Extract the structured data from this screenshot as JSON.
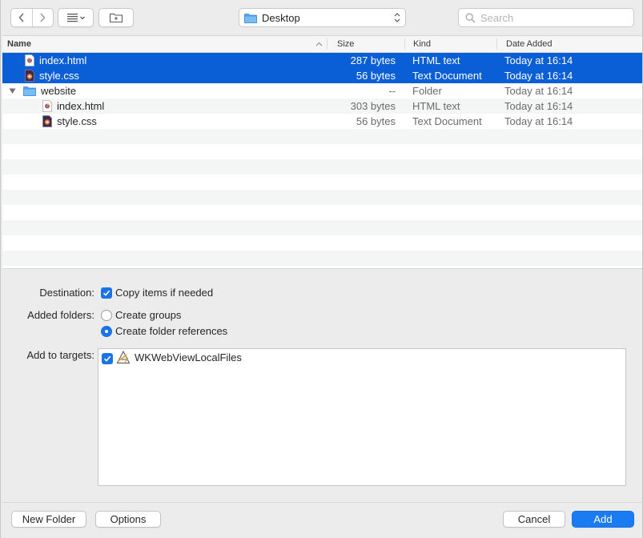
{
  "toolbar": {
    "location": "Desktop",
    "search_placeholder": "Search"
  },
  "columns": {
    "name": "Name",
    "size": "Size",
    "kind": "Kind",
    "date": "Date Added"
  },
  "files": [
    {
      "name": "index.html",
      "size": "287 bytes",
      "kind": "HTML text",
      "date": "Today at 16:14",
      "icon": "html-file-icon"
    },
    {
      "name": "style.css",
      "size": "56 bytes",
      "kind": "Text Document",
      "date": "Today at 16:14",
      "icon": "css-file-icon"
    },
    {
      "name": "website",
      "size": "--",
      "kind": "Folder",
      "date": "Today at 16:14",
      "icon": "folder-icon"
    },
    {
      "name": "index.html",
      "size": "303 bytes",
      "kind": "HTML text",
      "date": "Today at 16:14",
      "icon": "html-file-icon"
    },
    {
      "name": "style.css",
      "size": "56 bytes",
      "kind": "Text Document",
      "date": "Today at 16:14",
      "icon": "css-file-icon"
    }
  ],
  "options": {
    "destination_label": "Destination:",
    "copy_items": "Copy items if needed",
    "added_folders_label": "Added folders:",
    "create_groups": "Create groups",
    "create_folder_refs": "Create folder references",
    "add_to_targets_label": "Add to targets:",
    "target_name": "WKWebViewLocalFiles"
  },
  "buttons": {
    "new_folder": "New Folder",
    "options": "Options",
    "cancel": "Cancel",
    "add": "Add"
  },
  "colors": {
    "selection": "#0b5fd6",
    "accent": "#1a73e8",
    "primary_button": "#1b7cf2"
  }
}
